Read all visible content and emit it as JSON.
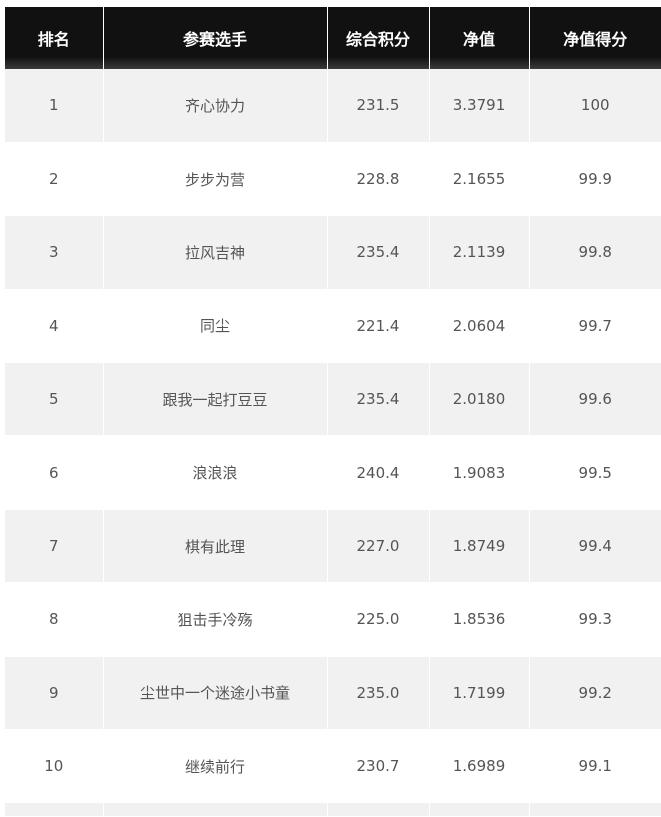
{
  "table": {
    "headers": [
      "排名",
      "参赛选手",
      "综合积分",
      "净值",
      "净值得分"
    ],
    "rows": [
      [
        "1",
        "齐心协力",
        "231.5",
        "3.3791",
        "100"
      ],
      [
        "2",
        "步步为营",
        "228.8",
        "2.1655",
        "99.9"
      ],
      [
        "3",
        "拉风吉神",
        "235.4",
        "2.1139",
        "99.8"
      ],
      [
        "4",
        "同尘",
        "221.4",
        "2.0604",
        "99.7"
      ],
      [
        "5",
        "跟我一起打豆豆",
        "235.4",
        "2.0180",
        "99.6"
      ],
      [
        "6",
        "浪浪浪",
        "240.4",
        "1.9083",
        "99.5"
      ],
      [
        "7",
        "棋有此理",
        "227.0",
        "1.8749",
        "99.4"
      ],
      [
        "8",
        "狙击手冷殇",
        "225.0",
        "1.8536",
        "99.3"
      ],
      [
        "9",
        "尘世中一个迷途小书童",
        "235.0",
        "1.7199",
        "99.2"
      ],
      [
        "10",
        "继续前行",
        "230.7",
        "1.6989",
        "99.1"
      ]
    ]
  },
  "colors": {
    "header_bg": "#111111",
    "header_text": "#ffffff",
    "row_odd_bg": "#f1f1f1",
    "row_even_bg": "#ffffff",
    "cell_text": "#555555"
  }
}
